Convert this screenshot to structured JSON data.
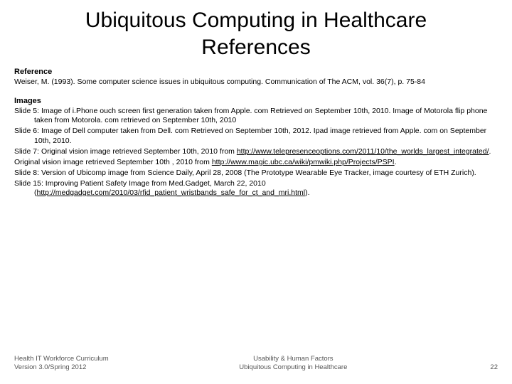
{
  "title": "Ubiquitous Computing in Healthcare References",
  "sections": {
    "reference": {
      "heading": "Reference",
      "items": [
        "Weiser, M. (1993). Some computer science issues in ubiquitous computing. Communication of The ACM, vol. 36(7), p. 75-84"
      ]
    },
    "images": {
      "heading": "Images",
      "items": [
        {
          "text": "Slide 5: Image of i.Phone ouch screen first generation taken from Apple. com Retrieved on September 10th, 2010. Image of Motorola flip phone taken from Motorola. com retrieved on September 10th, 2010"
        },
        {
          "text": "Slide 6: Image of Dell computer taken from Dell. com Retrieved on September 10th, 2012. Ipad image retrieved from Apple. com on September 10th, 2010."
        },
        {
          "prefix": "Slide 7: Original vision image retrieved September 10th, 2010 from ",
          "link": "http://www.telepresenceoptions.com/2011/10/the_worlds_largest_integrated/",
          "suffix": "."
        },
        {
          "prefix": "Original vision image retrieved September 10th , 2010 from ",
          "link": "http://www.magic.ubc.ca/wiki/pmwiki.php/Projects/PSPI",
          "suffix": "."
        },
        {
          "text": "Slide 8: Version of Ubicomp image from Science Daily, April 28, 2008 (The Prototype Wearable Eye Tracker, image courtesy of ETH Zurich)."
        },
        {
          "prefix": "Slide 15: Improving Patient Safety Image from Med.Gadget, March 22, 2010 (",
          "link": "http://medgadget.com/2010/03/rfid_patient_wristbands_safe_for_ct_and_mri.html",
          "suffix": ")."
        }
      ]
    }
  },
  "footer": {
    "left_line1": "Health IT Workforce Curriculum",
    "left_line2": "Version 3.0/Spring 2012",
    "center_line1": "Usability & Human Factors",
    "center_line2": "Ubiquitous Computing in Healthcare",
    "page": "22"
  }
}
